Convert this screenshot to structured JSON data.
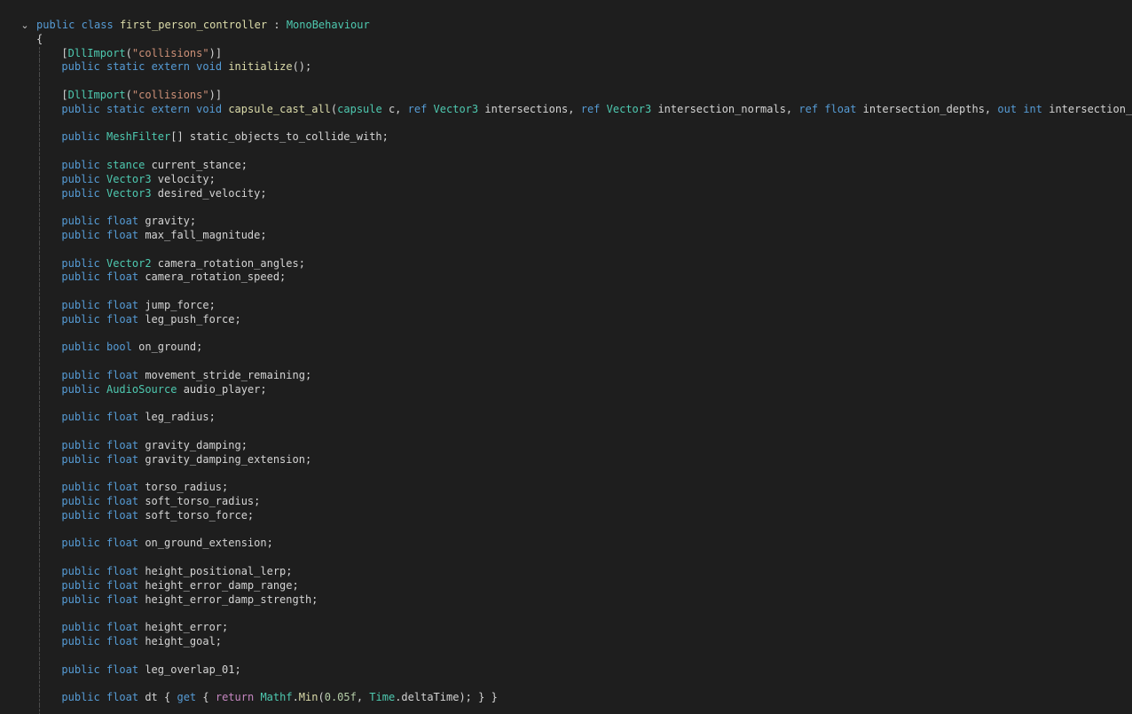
{
  "editor": {
    "fold_glyph": "⌄",
    "lines": [
      {
        "indent": 0,
        "fold": true,
        "tokens": [
          {
            "c": "kw",
            "t": "public"
          },
          {
            "c": "pn",
            "t": " "
          },
          {
            "c": "kw",
            "t": "class"
          },
          {
            "c": "pn",
            "t": " "
          },
          {
            "c": "fn",
            "t": "first_person_controller"
          },
          {
            "c": "pn",
            "t": " : "
          },
          {
            "c": "ty",
            "t": "MonoBehaviour"
          }
        ]
      },
      {
        "indent": 0,
        "tokens": [
          {
            "c": "pn",
            "t": "{"
          }
        ]
      },
      {
        "indent": 1,
        "tokens": [
          {
            "c": "pn",
            "t": "["
          },
          {
            "c": "ty",
            "t": "DllImport"
          },
          {
            "c": "pn",
            "t": "("
          },
          {
            "c": "st",
            "t": "\"collisions\""
          },
          {
            "c": "pn",
            "t": ")]"
          }
        ]
      },
      {
        "indent": 1,
        "tokens": [
          {
            "c": "kw",
            "t": "public"
          },
          {
            "c": "pn",
            "t": " "
          },
          {
            "c": "kw",
            "t": "static"
          },
          {
            "c": "pn",
            "t": " "
          },
          {
            "c": "kw",
            "t": "extern"
          },
          {
            "c": "pn",
            "t": " "
          },
          {
            "c": "kw",
            "t": "void"
          },
          {
            "c": "pn",
            "t": " "
          },
          {
            "c": "fn",
            "t": "initialize"
          },
          {
            "c": "pn",
            "t": "();"
          }
        ]
      },
      {
        "indent": 1,
        "tokens": []
      },
      {
        "indent": 1,
        "tokens": [
          {
            "c": "pn",
            "t": "["
          },
          {
            "c": "ty",
            "t": "DllImport"
          },
          {
            "c": "pn",
            "t": "("
          },
          {
            "c": "st",
            "t": "\"collisions\""
          },
          {
            "c": "pn",
            "t": ")]"
          }
        ]
      },
      {
        "indent": 1,
        "tokens": [
          {
            "c": "kw",
            "t": "public"
          },
          {
            "c": "pn",
            "t": " "
          },
          {
            "c": "kw",
            "t": "static"
          },
          {
            "c": "pn",
            "t": " "
          },
          {
            "c": "kw",
            "t": "extern"
          },
          {
            "c": "pn",
            "t": " "
          },
          {
            "c": "kw",
            "t": "void"
          },
          {
            "c": "pn",
            "t": " "
          },
          {
            "c": "fn",
            "t": "capsule_cast_all"
          },
          {
            "c": "pn",
            "t": "("
          },
          {
            "c": "ty",
            "t": "capsule"
          },
          {
            "c": "pn",
            "t": " c, "
          },
          {
            "c": "kw",
            "t": "ref"
          },
          {
            "c": "pn",
            "t": " "
          },
          {
            "c": "ty",
            "t": "Vector3"
          },
          {
            "c": "pn",
            "t": " intersections, "
          },
          {
            "c": "kw",
            "t": "ref"
          },
          {
            "c": "pn",
            "t": " "
          },
          {
            "c": "ty",
            "t": "Vector3"
          },
          {
            "c": "pn",
            "t": " intersection_normals, "
          },
          {
            "c": "kw",
            "t": "ref"
          },
          {
            "c": "pn",
            "t": " "
          },
          {
            "c": "kw",
            "t": "float"
          },
          {
            "c": "pn",
            "t": " intersection_depths, "
          },
          {
            "c": "kw",
            "t": "out"
          },
          {
            "c": "pn",
            "t": " "
          },
          {
            "c": "kw",
            "t": "int"
          },
          {
            "c": "pn",
            "t": " intersection_coun"
          }
        ]
      },
      {
        "indent": 1,
        "tokens": []
      },
      {
        "indent": 1,
        "tokens": [
          {
            "c": "kw",
            "t": "public"
          },
          {
            "c": "pn",
            "t": " "
          },
          {
            "c": "ty",
            "t": "MeshFilter"
          },
          {
            "c": "pn",
            "t": "[] static_objects_to_collide_with;"
          }
        ]
      },
      {
        "indent": 1,
        "tokens": []
      },
      {
        "indent": 1,
        "tokens": [
          {
            "c": "kw",
            "t": "public"
          },
          {
            "c": "pn",
            "t": " "
          },
          {
            "c": "ty",
            "t": "stance"
          },
          {
            "c": "pn",
            "t": " current_stance;"
          }
        ]
      },
      {
        "indent": 1,
        "tokens": [
          {
            "c": "kw",
            "t": "public"
          },
          {
            "c": "pn",
            "t": " "
          },
          {
            "c": "ty",
            "t": "Vector3"
          },
          {
            "c": "pn",
            "t": " velocity;"
          }
        ]
      },
      {
        "indent": 1,
        "tokens": [
          {
            "c": "kw",
            "t": "public"
          },
          {
            "c": "pn",
            "t": " "
          },
          {
            "c": "ty",
            "t": "Vector3"
          },
          {
            "c": "pn",
            "t": " desired_velocity;"
          }
        ]
      },
      {
        "indent": 1,
        "tokens": []
      },
      {
        "indent": 1,
        "tokens": [
          {
            "c": "kw",
            "t": "public"
          },
          {
            "c": "pn",
            "t": " "
          },
          {
            "c": "kw",
            "t": "float"
          },
          {
            "c": "pn",
            "t": " gravity;"
          }
        ]
      },
      {
        "indent": 1,
        "tokens": [
          {
            "c": "kw",
            "t": "public"
          },
          {
            "c": "pn",
            "t": " "
          },
          {
            "c": "kw",
            "t": "float"
          },
          {
            "c": "pn",
            "t": " max_fall_magnitude;"
          }
        ]
      },
      {
        "indent": 1,
        "tokens": []
      },
      {
        "indent": 1,
        "tokens": [
          {
            "c": "kw",
            "t": "public"
          },
          {
            "c": "pn",
            "t": " "
          },
          {
            "c": "ty",
            "t": "Vector2"
          },
          {
            "c": "pn",
            "t": " camera_rotation_angles;"
          }
        ]
      },
      {
        "indent": 1,
        "tokens": [
          {
            "c": "kw",
            "t": "public"
          },
          {
            "c": "pn",
            "t": " "
          },
          {
            "c": "kw",
            "t": "float"
          },
          {
            "c": "pn",
            "t": " camera_rotation_speed;"
          }
        ]
      },
      {
        "indent": 1,
        "tokens": []
      },
      {
        "indent": 1,
        "tokens": [
          {
            "c": "kw",
            "t": "public"
          },
          {
            "c": "pn",
            "t": " "
          },
          {
            "c": "kw",
            "t": "float"
          },
          {
            "c": "pn",
            "t": " jump_force;"
          }
        ]
      },
      {
        "indent": 1,
        "tokens": [
          {
            "c": "kw",
            "t": "public"
          },
          {
            "c": "pn",
            "t": " "
          },
          {
            "c": "kw",
            "t": "float"
          },
          {
            "c": "pn",
            "t": " leg_push_force;"
          }
        ]
      },
      {
        "indent": 1,
        "tokens": []
      },
      {
        "indent": 1,
        "tokens": [
          {
            "c": "kw",
            "t": "public"
          },
          {
            "c": "pn",
            "t": " "
          },
          {
            "c": "kw",
            "t": "bool"
          },
          {
            "c": "pn",
            "t": " on_ground;"
          }
        ]
      },
      {
        "indent": 1,
        "tokens": []
      },
      {
        "indent": 1,
        "tokens": [
          {
            "c": "kw",
            "t": "public"
          },
          {
            "c": "pn",
            "t": " "
          },
          {
            "c": "kw",
            "t": "float"
          },
          {
            "c": "pn",
            "t": " movement_stride_remaining;"
          }
        ]
      },
      {
        "indent": 1,
        "tokens": [
          {
            "c": "kw",
            "t": "public"
          },
          {
            "c": "pn",
            "t": " "
          },
          {
            "c": "ty",
            "t": "AudioSource"
          },
          {
            "c": "pn",
            "t": " audio_player;"
          }
        ]
      },
      {
        "indent": 1,
        "tokens": []
      },
      {
        "indent": 1,
        "tokens": [
          {
            "c": "kw",
            "t": "public"
          },
          {
            "c": "pn",
            "t": " "
          },
          {
            "c": "kw",
            "t": "float"
          },
          {
            "c": "pn",
            "t": " leg_radius;"
          }
        ]
      },
      {
        "indent": 1,
        "tokens": []
      },
      {
        "indent": 1,
        "tokens": [
          {
            "c": "kw",
            "t": "public"
          },
          {
            "c": "pn",
            "t": " "
          },
          {
            "c": "kw",
            "t": "float"
          },
          {
            "c": "pn",
            "t": " gravity_damping;"
          }
        ]
      },
      {
        "indent": 1,
        "tokens": [
          {
            "c": "kw",
            "t": "public"
          },
          {
            "c": "pn",
            "t": " "
          },
          {
            "c": "kw",
            "t": "float"
          },
          {
            "c": "pn",
            "t": " gravity_damping_extension;"
          }
        ]
      },
      {
        "indent": 1,
        "tokens": []
      },
      {
        "indent": 1,
        "tokens": [
          {
            "c": "kw",
            "t": "public"
          },
          {
            "c": "pn",
            "t": " "
          },
          {
            "c": "kw",
            "t": "float"
          },
          {
            "c": "pn",
            "t": " torso_radius;"
          }
        ]
      },
      {
        "indent": 1,
        "tokens": [
          {
            "c": "kw",
            "t": "public"
          },
          {
            "c": "pn",
            "t": " "
          },
          {
            "c": "kw",
            "t": "float"
          },
          {
            "c": "pn",
            "t": " soft_torso_radius;"
          }
        ]
      },
      {
        "indent": 1,
        "tokens": [
          {
            "c": "kw",
            "t": "public"
          },
          {
            "c": "pn",
            "t": " "
          },
          {
            "c": "kw",
            "t": "float"
          },
          {
            "c": "pn",
            "t": " soft_torso_force;"
          }
        ]
      },
      {
        "indent": 1,
        "tokens": []
      },
      {
        "indent": 1,
        "tokens": [
          {
            "c": "kw",
            "t": "public"
          },
          {
            "c": "pn",
            "t": " "
          },
          {
            "c": "kw",
            "t": "float"
          },
          {
            "c": "pn",
            "t": " on_ground_extension;"
          }
        ]
      },
      {
        "indent": 1,
        "tokens": []
      },
      {
        "indent": 1,
        "tokens": [
          {
            "c": "kw",
            "t": "public"
          },
          {
            "c": "pn",
            "t": " "
          },
          {
            "c": "kw",
            "t": "float"
          },
          {
            "c": "pn",
            "t": " height_positional_lerp;"
          }
        ]
      },
      {
        "indent": 1,
        "tokens": [
          {
            "c": "kw",
            "t": "public"
          },
          {
            "c": "pn",
            "t": " "
          },
          {
            "c": "kw",
            "t": "float"
          },
          {
            "c": "pn",
            "t": " height_error_damp_range;"
          }
        ]
      },
      {
        "indent": 1,
        "tokens": [
          {
            "c": "kw",
            "t": "public"
          },
          {
            "c": "pn",
            "t": " "
          },
          {
            "c": "kw",
            "t": "float"
          },
          {
            "c": "pn",
            "t": " height_error_damp_strength;"
          }
        ]
      },
      {
        "indent": 1,
        "tokens": []
      },
      {
        "indent": 1,
        "tokens": [
          {
            "c": "kw",
            "t": "public"
          },
          {
            "c": "pn",
            "t": " "
          },
          {
            "c": "kw",
            "t": "float"
          },
          {
            "c": "pn",
            "t": " height_error;"
          }
        ]
      },
      {
        "indent": 1,
        "tokens": [
          {
            "c": "kw",
            "t": "public"
          },
          {
            "c": "pn",
            "t": " "
          },
          {
            "c": "kw",
            "t": "float"
          },
          {
            "c": "pn",
            "t": " height_goal;"
          }
        ]
      },
      {
        "indent": 1,
        "tokens": []
      },
      {
        "indent": 1,
        "tokens": [
          {
            "c": "kw",
            "t": "public"
          },
          {
            "c": "pn",
            "t": " "
          },
          {
            "c": "kw",
            "t": "float"
          },
          {
            "c": "pn",
            "t": " leg_overlap_01;"
          }
        ]
      },
      {
        "indent": 1,
        "tokens": []
      },
      {
        "indent": 1,
        "tokens": [
          {
            "c": "kw",
            "t": "public"
          },
          {
            "c": "pn",
            "t": " "
          },
          {
            "c": "kw",
            "t": "float"
          },
          {
            "c": "pn",
            "t": " dt { "
          },
          {
            "c": "kw",
            "t": "get"
          },
          {
            "c": "pn",
            "t": " { "
          },
          {
            "c": "cf",
            "t": "return"
          },
          {
            "c": "pn",
            "t": " "
          },
          {
            "c": "ty",
            "t": "Mathf"
          },
          {
            "c": "pn",
            "t": "."
          },
          {
            "c": "fn",
            "t": "Min"
          },
          {
            "c": "pn",
            "t": "("
          },
          {
            "c": "nm",
            "t": "0.05f"
          },
          {
            "c": "pn",
            "t": ", "
          },
          {
            "c": "ty",
            "t": "Time"
          },
          {
            "c": "pn",
            "t": ".deltaTime); } }"
          }
        ]
      },
      {
        "indent": 1,
        "tokens": []
      }
    ]
  }
}
